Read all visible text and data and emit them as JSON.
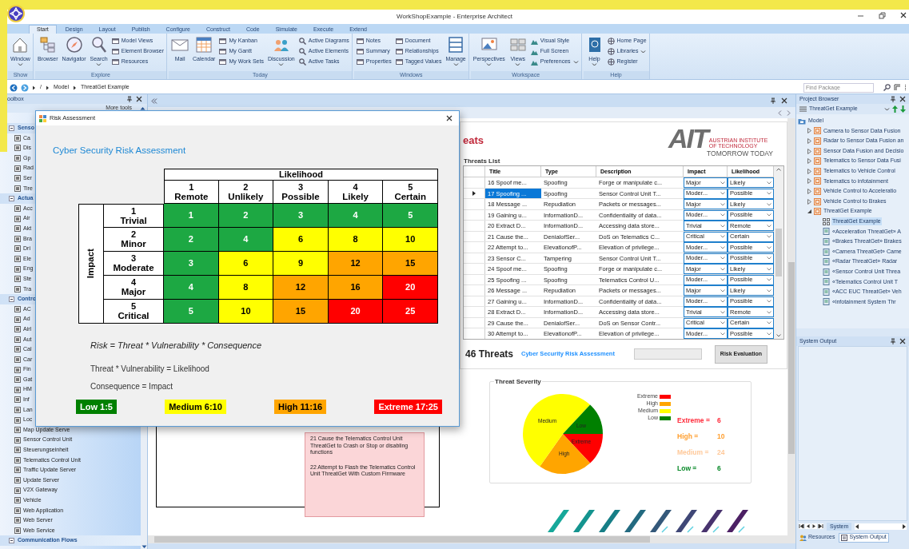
{
  "window": {
    "title": "WorkShopExample - Enterprise Architect"
  },
  "ribbon_tabs": [
    {
      "label": "Start",
      "selected": true
    },
    {
      "label": "Design",
      "selected": false
    },
    {
      "label": "Layout",
      "selected": false
    },
    {
      "label": "Publish",
      "selected": false
    },
    {
      "label": "Configure",
      "selected": false
    },
    {
      "label": "Construct",
      "selected": false
    },
    {
      "label": "Code",
      "selected": false
    },
    {
      "label": "Simulate",
      "selected": false
    },
    {
      "label": "Execute",
      "selected": false
    },
    {
      "label": "Extend",
      "selected": false
    }
  ],
  "ribbon_groups": [
    {
      "label": "Show",
      "controls": [
        {
          "kind": "large",
          "label": "Window",
          "menu": true
        }
      ]
    },
    {
      "label": "Explore",
      "controls": [
        {
          "kind": "large",
          "label": "Browser",
          "menu": false
        },
        {
          "kind": "large",
          "label": "Navigator",
          "menu": false
        },
        {
          "kind": "large",
          "label": "Search",
          "menu": true
        },
        {
          "kind": "stack",
          "items": [
            {
              "label": "Model Views",
              "menu": false
            },
            {
              "label": "Element Browser",
              "menu": false
            },
            {
              "label": "Resources",
              "menu": false
            }
          ]
        }
      ]
    },
    {
      "label": "Today",
      "controls": [
        {
          "kind": "large",
          "label": "Mail",
          "menu": false
        },
        {
          "kind": "large",
          "label": "Calendar",
          "menu": false
        },
        {
          "kind": "stack",
          "items": [
            {
              "label": "My Kanban",
              "menu": false
            },
            {
              "label": "My Gantt",
              "menu": false
            },
            {
              "label": "My Work Sets",
              "menu": false
            }
          ]
        },
        {
          "kind": "large",
          "label": "Discussion",
          "menu": true
        },
        {
          "kind": "stack",
          "items": [
            {
              "label": "Active Diagrams",
              "menu": false
            },
            {
              "label": "Active Elements",
              "menu": false
            },
            {
              "label": "Active Tasks",
              "menu": false
            }
          ]
        }
      ]
    },
    {
      "label": "Windows",
      "controls": [
        {
          "kind": "stack",
          "items": [
            {
              "label": "Notes",
              "menu": false
            },
            {
              "label": "Summary",
              "menu": false
            },
            {
              "label": "Properties",
              "menu": false
            }
          ]
        },
        {
          "kind": "stack",
          "items": [
            {
              "label": "Document",
              "menu": false
            },
            {
              "label": "Relationships",
              "menu": false
            },
            {
              "label": "Tagged Values",
              "menu": false
            }
          ]
        },
        {
          "kind": "large",
          "label": "Manage",
          "menu": true
        }
      ]
    },
    {
      "label": "Workspace",
      "controls": [
        {
          "kind": "large",
          "label": "Perspectives",
          "menu": true
        },
        {
          "kind": "large",
          "label": "Views",
          "menu": true
        },
        {
          "kind": "stack",
          "items": [
            {
              "label": "Visual Style",
              "menu": false
            },
            {
              "label": "Full Screen",
              "menu": false
            },
            {
              "label": "Preferences",
              "menu": true
            }
          ]
        }
      ]
    },
    {
      "label": "Help",
      "controls": [
        {
          "kind": "large",
          "label": "Help",
          "menu": true
        },
        {
          "kind": "stack",
          "items": [
            {
              "label": "Home Page",
              "menu": false
            },
            {
              "label": "Libraries",
              "menu": true
            },
            {
              "label": "Register",
              "menu": false
            }
          ]
        }
      ]
    }
  ],
  "breadcrumb": [
    "/",
    "Model",
    "ThreatGet Example"
  ],
  "find_package": {
    "placeholder": "Find Package"
  },
  "toolbox": {
    "title": "oolbox",
    "more_tools": "More tools",
    "sections": [
      {
        "label": "Senso",
        "items": [
          "Ca",
          "Dis",
          "Gp",
          "Rad",
          "Ser",
          "Tire"
        ]
      },
      {
        "label": "Actua",
        "items": [
          "Acc",
          "Air",
          "Akt",
          "Bra",
          "Dri",
          "Ele",
          "Eng",
          "Ste",
          "Tra"
        ]
      },
      {
        "label": "Contro",
        "items": [
          "AC",
          "Ad",
          "Airl",
          "Aut",
          "Cal",
          "Car",
          "Fin",
          "Gat",
          "HM",
          "Inf",
          "Lan",
          "Loc",
          "Map Update Serve",
          "Sensor Control Unit",
          "Steuerungseinheit",
          "Telematics Control Unit",
          "Traffic Update Server",
          "Update Server",
          "V2X Gateway",
          "Vehicle",
          "Web Application",
          "Web Server",
          "Web Service"
        ]
      },
      {
        "label": "Communication Flows"
      }
    ]
  },
  "risk_dialog": {
    "title": "Risk Assessment",
    "heading": "Cyber Security Risk Assessment",
    "likelihood_label": "Likelihood",
    "impact_label": "Impact",
    "likelihood_levels": [
      {
        "number": "1",
        "name": "Remote"
      },
      {
        "number": "2",
        "name": "Unlikely"
      },
      {
        "number": "3",
        "name": "Possible"
      },
      {
        "number": "4",
        "name": "Likely"
      },
      {
        "number": "5",
        "name": "Certain"
      }
    ],
    "impact_levels": [
      {
        "number": "1",
        "name": "Trivial",
        "cells": [
          {
            "value": "1",
            "color": "#1da843"
          },
          {
            "value": "2",
            "color": "#1da843"
          },
          {
            "value": "3",
            "color": "#1da843"
          },
          {
            "value": "4",
            "color": "#1da843"
          },
          {
            "value": "5",
            "color": "#1da843"
          }
        ]
      },
      {
        "number": "2",
        "name": "Minor",
        "cells": [
          {
            "value": "2",
            "color": "#1da843"
          },
          {
            "value": "4",
            "color": "#1da843"
          },
          {
            "value": "6",
            "color": "#ffff00"
          },
          {
            "value": "8",
            "color": "#ffff00"
          },
          {
            "value": "10",
            "color": "#ffff00"
          }
        ]
      },
      {
        "number": "3",
        "name": "Moderate",
        "cells": [
          {
            "value": "3",
            "color": "#1da843"
          },
          {
            "value": "6",
            "color": "#ffff00"
          },
          {
            "value": "9",
            "color": "#ffff00"
          },
          {
            "value": "12",
            "color": "#ffa500"
          },
          {
            "value": "15",
            "color": "#ffa500"
          }
        ]
      },
      {
        "number": "4",
        "name": "Major",
        "cells": [
          {
            "value": "4",
            "color": "#1da843"
          },
          {
            "value": "8",
            "color": "#ffff00"
          },
          {
            "value": "12",
            "color": "#ffa500"
          },
          {
            "value": "16",
            "color": "#ffa500"
          },
          {
            "value": "20",
            "color": "#ff0000"
          }
        ]
      },
      {
        "number": "5",
        "name": "Critical",
        "cells": [
          {
            "value": "5",
            "color": "#1da843"
          },
          {
            "value": "10",
            "color": "#ffff00"
          },
          {
            "value": "15",
            "color": "#ffa500"
          },
          {
            "value": "20",
            "color": "#ff0000"
          },
          {
            "value": "25",
            "color": "#ff0000"
          }
        ]
      }
    ],
    "formula": "Risk = Threat * Vulnerability * Consequence",
    "notes": [
      "Threat * Vulnerability = Likelihood",
      "Consequence = Impact"
    ],
    "bands": [
      {
        "label": "Low 1:5",
        "color": "#008000"
      },
      {
        "label": "Medium 6:10",
        "color": "#ffff00"
      },
      {
        "label": "High 11:16",
        "color": "#ffa500"
      },
      {
        "label": "Extreme 17:25",
        "color": "#ff0000"
      }
    ]
  },
  "diagram_notes": [
    "21 Cause the Telematics Control Unit ThreatGet to Crash or Stop or disabling functions",
    "22 Attempt to Flash the Telematics Control Unit ThreatGet With Custom Firmware"
  ],
  "threat_form": {
    "title": "eats",
    "logo": {
      "letters": "AIT",
      "institute": "AUSTRIAN INSTITUTE OF TECHNOLOGY",
      "slogan": "TOMORROW TODAY"
    },
    "list_label": "Threats List",
    "columns": [
      "Title",
      "Type",
      "Description",
      "Impact",
      "Likelihood"
    ],
    "rows": [
      {
        "title": "16 Spoof me...",
        "type": "Spoofing",
        "description": "Forge or manipulate c...",
        "impact": "Major",
        "likelihood": "Likely",
        "selected": false
      },
      {
        "title": "17 Spoofing ...",
        "type": "Spoofing",
        "description": "Sensor Control Unit T...",
        "impact": "Moder...",
        "likelihood": "Possible",
        "selected": true
      },
      {
        "title": "18 Message ...",
        "type": "Repudiation",
        "description": "Packets or messages...",
        "impact": "Major",
        "likelihood": "Likely",
        "selected": false
      },
      {
        "title": "19 Gaining u...",
        "type": "InformationD...",
        "description": "Confidentiality of data...",
        "impact": "Moder...",
        "likelihood": "Possible",
        "selected": false
      },
      {
        "title": "20 Extract D...",
        "type": "InformationD...",
        "description": "Accessing data store...",
        "impact": "Trivial",
        "likelihood": "Remote",
        "selected": false
      },
      {
        "title": "21 Cause the...",
        "type": "DenialofSer...",
        "description": "DoS on Telematics C...",
        "impact": "Critical",
        "likelihood": "Certain",
        "selected": false
      },
      {
        "title": "22 Attempt to...",
        "type": "ElevationofP...",
        "description": "Elevation of privilege...",
        "impact": "Moder...",
        "likelihood": "Possible",
        "selected": false
      },
      {
        "title": "23 Sensor C...",
        "type": "Tampering",
        "description": "Sensor Control Unit T...",
        "impact": "Moder...",
        "likelihood": "Possible",
        "selected": false
      },
      {
        "title": "24 Spoof me...",
        "type": "Spoofing",
        "description": "Forge or manipulate c...",
        "impact": "Major",
        "likelihood": "Likely",
        "selected": false
      },
      {
        "title": "25 Spoofing ...",
        "type": "Spoofing",
        "description": "Telematics Control U...",
        "impact": "Moder...",
        "likelihood": "Possible",
        "selected": false
      },
      {
        "title": "26 Message ...",
        "type": "Repudiation",
        "description": "Packets or messages...",
        "impact": "Major",
        "likelihood": "Likely",
        "selected": false
      },
      {
        "title": "27 Gaining u...",
        "type": "InformationD...",
        "description": "Confidentiality of data...",
        "impact": "Moder...",
        "likelihood": "Possible",
        "selected": false
      },
      {
        "title": "28 Extract D...",
        "type": "InformationD...",
        "description": "Accessing data store...",
        "impact": "Trivial",
        "likelihood": "Remote",
        "selected": false
      },
      {
        "title": "29 Cause the...",
        "type": "DenialofSer...",
        "description": "DoS on Sensor Contr...",
        "impact": "Critical",
        "likelihood": "Certain",
        "selected": false
      },
      {
        "title": "30 Attempt to...",
        "type": "ElevationofP...",
        "description": "Elevation of privilege...",
        "impact": "Moder...",
        "likelihood": "Possible",
        "selected": false
      }
    ],
    "count": "46 Threats",
    "link": "Cyber Security Risk Assessment",
    "button": "Risk Evaluation",
    "severity": {
      "title": "Threat Severity",
      "slice_labels": [
        "Extreme",
        "High",
        "Medium",
        "Low"
      ],
      "legend": [
        {
          "label": "Extreme",
          "color": "#ff0000"
        },
        {
          "label": "High",
          "color": "#ffa500"
        },
        {
          "label": "Medium",
          "color": "#ffff00"
        },
        {
          "label": "Low",
          "color": "#008000"
        }
      ],
      "totals": [
        {
          "label": "Extreme =",
          "value": "6",
          "color": "#ff2d3c"
        },
        {
          "label": "High =",
          "value": "10",
          "color": "#ff9f30"
        },
        {
          "label": "Medium =",
          "value": "24",
          "color": "#ffc99a"
        },
        {
          "label": "Low =",
          "value": "6",
          "color": "#0a8a2a"
        }
      ]
    }
  },
  "project_browser": {
    "title": "Project Browser",
    "package": "ThreatGet Example",
    "tree": [
      {
        "label": "Model",
        "selected": false,
        "children": [
          {
            "label": "Camera to Sensor Data Fusion",
            "expanded": false,
            "selected": false
          },
          {
            "label": "Radar to Sensor Data Fusion an",
            "expanded": false,
            "selected": false
          },
          {
            "label": "Sensor Data Fusion and Decisio",
            "expanded": false,
            "selected": false
          },
          {
            "label": "Telematics to Sensor Data Fusi",
            "expanded": false,
            "selected": false
          },
          {
            "label": "Telematics to Vehicle Control",
            "expanded": false,
            "selected": false
          },
          {
            "label": "Telematics to infotainment",
            "expanded": false,
            "selected": false
          },
          {
            "label": "Vehicle Control to Acceleratio",
            "expanded": false,
            "selected": false
          },
          {
            "label": "Vehicle Control to Brakes",
            "expanded": false,
            "selected": false
          },
          {
            "label": "ThreatGet Example",
            "expanded": true,
            "selected": false,
            "children": [
              {
                "label": "ThreatGet Example",
                "selected": true
              },
              {
                "label": "«Acceleration ThreatGet» A",
                "selected": false
              },
              {
                "label": "«Brakes ThreatGet» Brakes",
                "selected": false
              },
              {
                "label": "«Camera ThreatGet» Came",
                "selected": false
              },
              {
                "label": "«Radar ThreatGet» Radar",
                "selected": false
              },
              {
                "label": "«Sensor Control Unit Threa",
                "selected": false
              },
              {
                "label": "«Telematics Control Unit T",
                "selected": false
              },
              {
                "label": "«ACC EUC ThreatGet» Veh",
                "selected": false
              },
              {
                "label": "«infotainment System Thr",
                "selected": false
              }
            ]
          }
        ]
      }
    ]
  },
  "system_output": {
    "title": "System Output",
    "tabs": [
      {
        "label": "System",
        "selected": true
      }
    ]
  },
  "bottom_tabs": [
    {
      "label": "Resources",
      "selected": false
    },
    {
      "label": "System Output",
      "selected": true
    }
  ]
}
